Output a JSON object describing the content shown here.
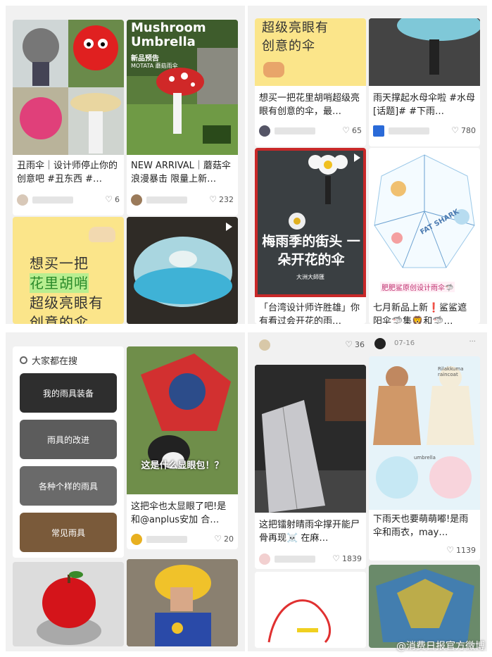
{
  "q1": {
    "c1": {
      "caption": "丑雨伞｜设计师停止你的创意吧 #丑东西 #…",
      "likes": "6"
    },
    "c2": {
      "overlay_title": "Mushroom Umbrella",
      "overlay_sub": "新品预告",
      "overlay_brand": "MOTATA 蘑菇雨伞",
      "caption": "NEW ARRIVAL｜蘑菇伞浪漫暴击 限量上新…",
      "likes": "232"
    },
    "c3": {
      "lines": [
        "想买一把",
        "花里胡哨",
        "超级亮眼有",
        "创意的伞"
      ]
    }
  },
  "q2": {
    "c1": {
      "lines": [
        "超级亮眼有",
        "创意的伞"
      ],
      "caption": "想买一把花里胡哨超级亮眼有创意的伞，最…",
      "likes": "65"
    },
    "c2": {
      "caption": "雨天撑起水母伞啦 #水母[话题]# #下雨…",
      "likes": "780"
    },
    "c3": {
      "overlay": "梅雨季的街头 一朵开花的伞",
      "overlay_small": "大洲大師匯",
      "caption": "「台湾设计师许胜雄」你有看过会开花的雨…"
    },
    "c4": {
      "overlay": "FAT SHARK",
      "banner": "肥肥鲨原创设计雨伞🦈",
      "caption": "七月新品上新❗鲨鲨遮阳伞🦈集🦁和🦈…"
    }
  },
  "q3": {
    "search_label": "大家都在搜",
    "pills": [
      "我的雨具装备",
      "雨具的改进",
      "各种个样的雨具",
      "常见雨具"
    ],
    "c1": {
      "overlay": "这是什么显眼包！？",
      "caption": "这把伞也太显眼了吧!是和@anplus安加 合…",
      "likes": "20"
    }
  },
  "q4": {
    "top_likes": "36",
    "top_date": "07-16",
    "c1": {
      "caption": "这把镭射晴雨伞撑开能尸骨再现☠️ 在麻…",
      "likes": "1839"
    },
    "c2": {
      "overlay": "Rilakkuma raincoat",
      "overlay2": "umbrella",
      "caption": "下雨天也要萌萌嘟!是雨伞和雨衣，may…",
      "likes": "1139"
    }
  },
  "watermark": "@消费日报官方微博"
}
